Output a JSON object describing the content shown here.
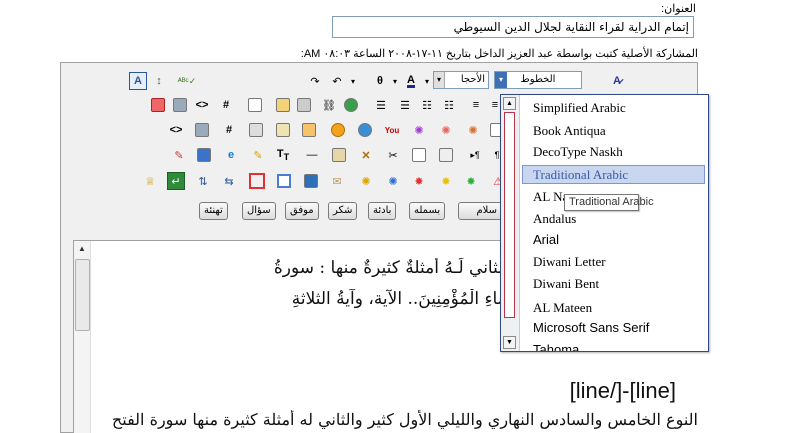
{
  "form": {
    "title_label": "العنوان:",
    "title_value": "إتمام الدراية لقراء النقاية لجلال الدين السيوطي",
    "posted_info": "المشاركة الأصلية كتبت بواسطة عبد العزيز الداخل بتاريخ ١١-١٧-٢٠٠٨ الساعة ٠٨:٠٣ AM:"
  },
  "toolbar": {
    "font_select_value": "الخطوط",
    "size_select_value": "الأحجا",
    "quick_buttons": [
      "تهنئة",
      "سؤال",
      "موفق",
      "شكر",
      "بادئة",
      "بسمله",
      "سلام"
    ]
  },
  "dropdown": {
    "fonts": [
      "Simplified Arabic",
      "Book Antiqua",
      "DecoType Naskh",
      "Traditional Arabic",
      "AL Nas",
      "Andalus",
      "Arial",
      "Diwani Letter",
      "Diwani Bent",
      "AL Mateen",
      "Microsoft Sans Serif",
      "Tahoma"
    ],
    "selected": "Traditional Arabic",
    "tooltip": "Traditional Arabic"
  },
  "content": {
    "line1": "هاريُّ والليليُّ، الأولُ كثيرٌ، والثاني لَـهُ أمثلةٌ كثيرةٌ منها : سورةُ",
    "line2": "لنَّبِيُّ قُلْ لِأَزْوَاجِكَ وَبَنَاتِكَ وَنِسَاءِ الْمُؤْمِنِينَ.. الآية، وآيةُ الثلاثةِ",
    "line_tag": "[line]-[/line]",
    "line3": "النوع الخامس والسادس النهاري والليلي الأول كثير والثاني له أمثلة كثيرة منها سورة الفتح"
  },
  "colors": {
    "selected_bg": "#c8d6f0",
    "selected_text": "#3a5aa5",
    "dropdown_border": "#2e4a86"
  }
}
